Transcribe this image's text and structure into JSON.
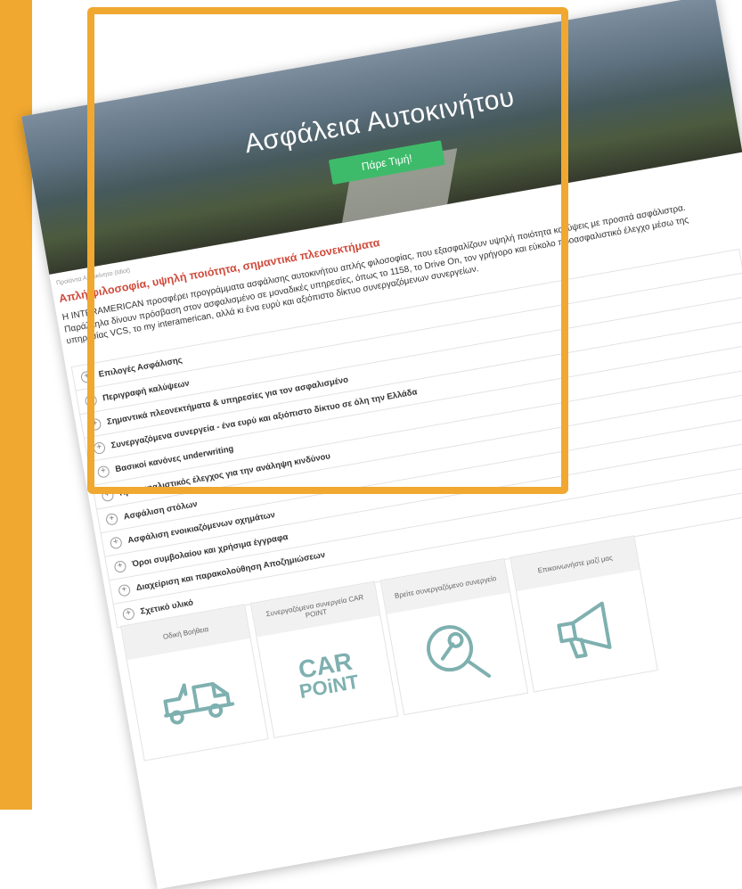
{
  "hero": {
    "title": "Ασφάλεια Αυτοκινήτου",
    "button": "Πάρε Τιμή!"
  },
  "breadcrumb": "Προϊόντα   Αυτοκίνητο (Idiot)",
  "subtitle": "Απλή φιλοσοφία, υψηλή ποιότητα, σημαντικά πλεονεκτήματα",
  "intro": "Η INTERAMERICAN προσφέρει προγράμματα ασφάλισης αυτοκινήτου απλής φιλοσοφίας, που εξασφαλίζουν υψηλή ποιότητα καλύψεις με προσιτά ασφάλιστρα. Παράλληλα δίνουν πρόσβαση στον ασφαλισμένο σε μοναδικές υπηρεσίες, όπως το 1158, το Drive On, τον γρήγορο και εύκολο προασφαλιστικό έλεγχο μέσω της υπηρεσίας VCS, το my interamerican, αλλά κι ένα ευρύ και αξιόπιστο δίκτυο συνεργαζόμενων συνεργείων.",
  "accordion": [
    "Επιλογές Ασφάλισης",
    "Περιγραφή καλύψεων",
    "Σημαντικά πλεονεκτήματα & υπηρεσίες για τον ασφαλισμένο",
    "Συνεργαζόμενα συνεργεία - ένα ευρύ και αξιόπιστο δίκτυο σε όλη την Ελλάδα",
    "Βασικοί κανόνες underwriting",
    "Προασφαλιστικός έλεγχος για την ανάληψη κινδύνου",
    "Ασφάλιση στόλων",
    "Ασφάλιση ενοικιαζόμενων οχημάτων",
    "Όροι συμβολαίου και χρήσιμα έγγραφα",
    "Διαχείριση και παρακολούθηση Αποζημιώσεων",
    "Σχετικό υλικό"
  ],
  "tiles": [
    {
      "label": "Οδική Βοήθεια",
      "icon": "tow-truck-icon"
    },
    {
      "label": "Συνεργαζόμενα συνεργεία CAR POINT",
      "icon": "car-point-logo"
    },
    {
      "label": "Βρείτε συνεργαζόμενο συνεργείο",
      "icon": "wrench-search-icon"
    },
    {
      "label": "Επικοινωνήστε μαζί μας",
      "icon": "megaphone-icon"
    }
  ],
  "carpoint": {
    "line1": "CAR",
    "line2": "POiNT"
  },
  "colors": {
    "frame": "#f0a830",
    "accent_red": "#d04a3b",
    "button_green": "#3dbb6a",
    "icon_teal": "#7fb0b0"
  }
}
